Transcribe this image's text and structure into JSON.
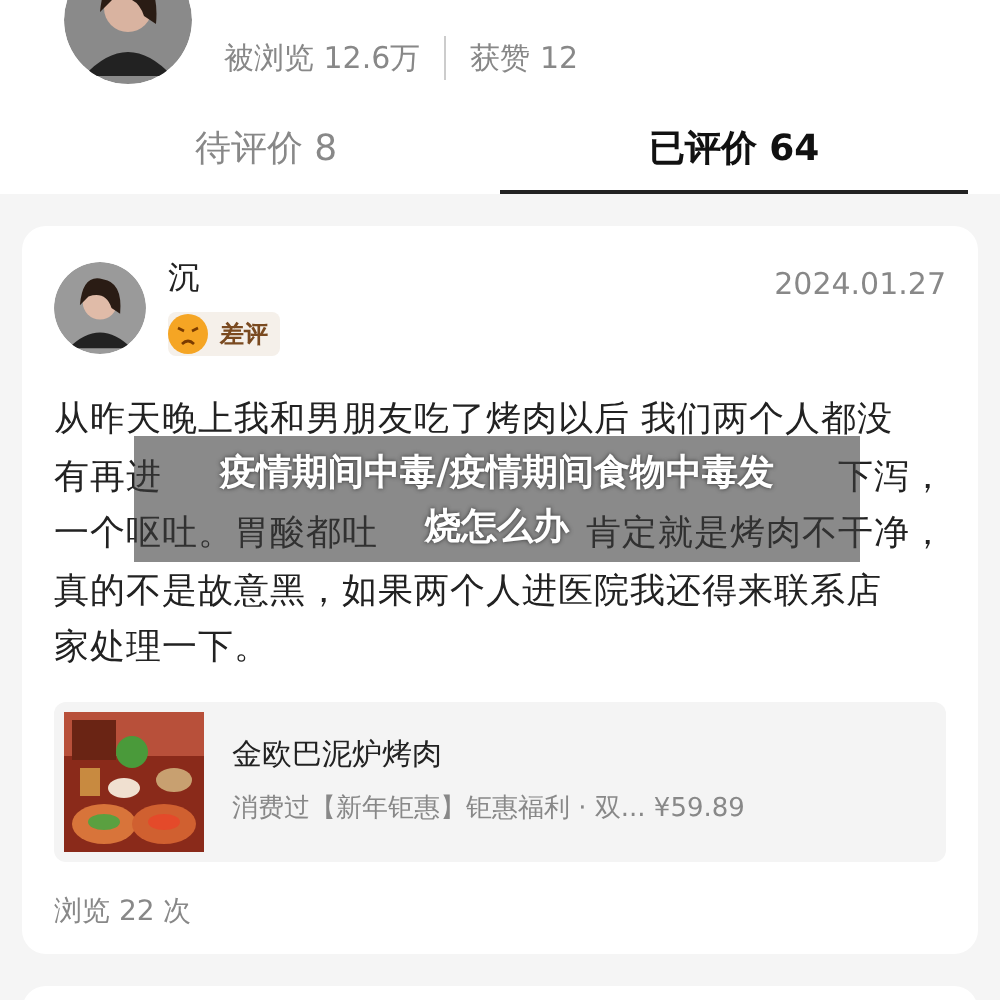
{
  "profile": {
    "stats": [
      {
        "label": "被浏览",
        "value": "12.6万"
      },
      {
        "label": "获赞",
        "value": "12"
      }
    ]
  },
  "tabs": [
    {
      "label": "待评价 8",
      "selected": false
    },
    {
      "label": "已评价 64",
      "selected": true
    }
  ],
  "review": {
    "author": "沉",
    "date": "2024.01.27",
    "rating": {
      "label": "差评",
      "kind": "bad"
    },
    "lines": [
      {
        "text": "从昨天晚上我和男朋友吃了烤肉以后 我们两个人都没"
      },
      {
        "text": "有再进",
        "tail": "下泻，"
      },
      {
        "text": "一个呕吐。胃酸都吐",
        "tail": "肯定就是烤肉不干净，"
      },
      {
        "text": "真的不是故意黑，如果两个人进医院我还得来联系店"
      },
      {
        "text": "家处理一下。"
      }
    ],
    "shop": {
      "kind": "picture",
      "name": "金欧巴泥炉烤肉",
      "detail": "消费过【新年钜惠】钜惠福利 · 双... ¥59.89"
    },
    "views": "浏览 22 次"
  },
  "overlay_title": "疫情期间中毒/疫情期间食物中毒发烧怎么办"
}
